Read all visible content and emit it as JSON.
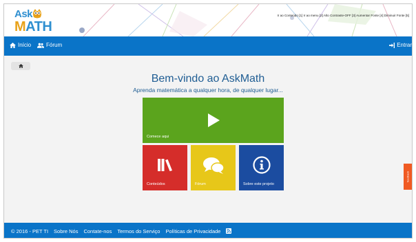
{
  "header": {
    "logo_top": "Ask",
    "logo_bottom_1": "M",
    "logo_bottom_2": "ATH",
    "accessibility_bar": "Ir ao Conteúdo [1] Ir ao menu [2] Alto Contraste-OFF [3] Aumentar Fonte [4] Diminuir Fonte [5]"
  },
  "nav": {
    "home_label": "Início",
    "forum_label": "Fórum",
    "login_label": "Entrar"
  },
  "main": {
    "title": "Bem-vindo ao AskMath",
    "subtitle": "Aprenda matemática a qualquer hora, de qualquer lugar...",
    "tiles": {
      "start_label": "Comece aqui",
      "contents_label": "Conteúdos",
      "forum_label": "Fórum",
      "about_label": "Sobre este projeto"
    },
    "feedback_label": "feedback"
  },
  "footer": {
    "copyright": "© 2016 - PET TI",
    "about": "Sobre Nós",
    "contact": "Contate-nos",
    "terms": "Termos do Serviço",
    "privacy": "Políticas de Privacidade"
  },
  "colors": {
    "primary": "#0a74c8",
    "green_tile": "#5ba41d",
    "red_tile": "#d52d2a",
    "yellow_tile": "#e7c719",
    "blue_tile": "#1b4ca0",
    "feedback": "#f05a22"
  },
  "icons": {
    "home": "home-icon",
    "forum": "users-icon",
    "login": "sign-in-icon",
    "start": "play-icon",
    "contents": "books-icon",
    "forum_tile": "chat-bubbles-icon",
    "about": "info-icon",
    "rss": "rss-icon"
  }
}
